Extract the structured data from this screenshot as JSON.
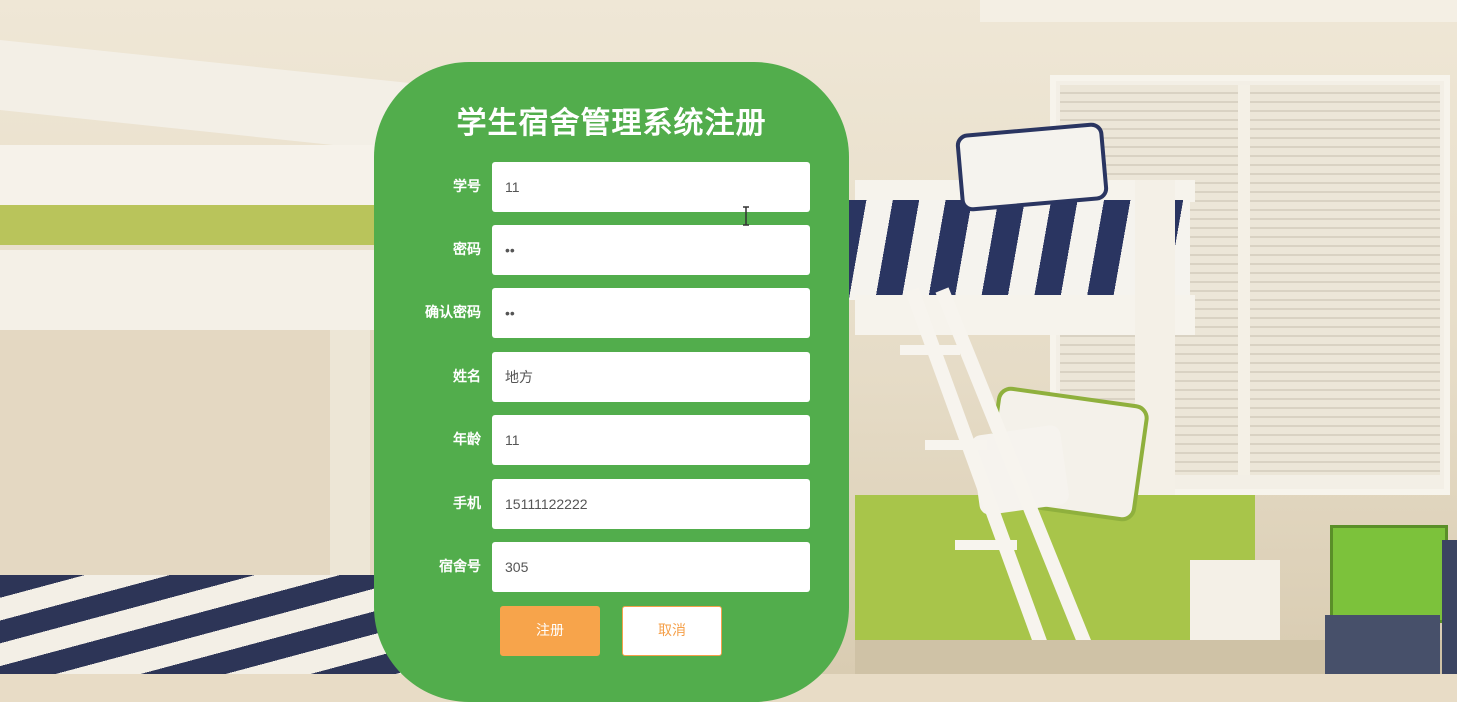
{
  "form": {
    "title": "学生宿舍管理系统注册",
    "fields": [
      {
        "label": "学号",
        "value": "11"
      },
      {
        "label": "密码",
        "value": "••"
      },
      {
        "label": "确认密码",
        "value": "••"
      },
      {
        "label": "姓名",
        "value": "地方"
      },
      {
        "label": "年龄",
        "value": "11"
      },
      {
        "label": "手机",
        "value": "15111122222"
      },
      {
        "label": "宿舍号",
        "value": "305"
      }
    ],
    "register_label": "注册",
    "cancel_label": "取消"
  },
  "colors": {
    "panel": "#52ad4c",
    "register_button": "#f7a44b",
    "cancel_border": "#f5a04a"
  },
  "background": {
    "description_icon": "bunk-bed-bedroom-photo"
  },
  "cursor_icon": "text-cursor-icon"
}
